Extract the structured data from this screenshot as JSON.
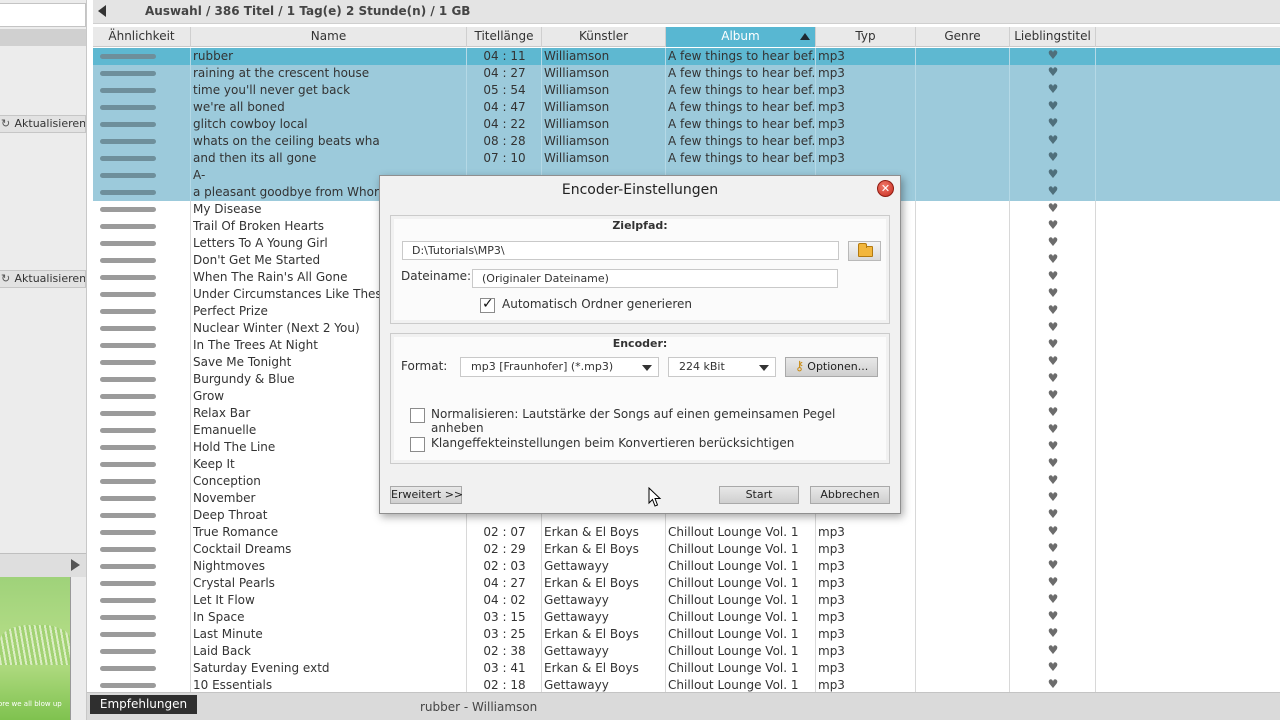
{
  "breadcrumb": "Auswahl  /  386 Titel  /  1 Tag(e) 2 Stunde(n)  /  1 GB",
  "sidebar": {
    "refresh_label": "Aktualisieren",
    "thumbnail_caption": "ore we all blow up"
  },
  "table": {
    "columns": [
      {
        "key": "sim",
        "label": "Ähnlichkeit"
      },
      {
        "key": "name",
        "label": "Name"
      },
      {
        "key": "len",
        "label": "Titellänge"
      },
      {
        "key": "artist",
        "label": "Künstler"
      },
      {
        "key": "album",
        "label": "Album",
        "sorted": "asc"
      },
      {
        "key": "type",
        "label": "Typ"
      },
      {
        "key": "genre",
        "label": "Genre"
      },
      {
        "key": "fav",
        "label": "Lieblingstitel"
      }
    ],
    "rows": [
      {
        "name": "rubber",
        "len": "04 : 11",
        "artist": "Williamson",
        "album": "A few things to hear bef...",
        "type": "mp3",
        "sel": true,
        "first": true
      },
      {
        "name": "raining at the crescent house",
        "len": "04 : 27",
        "artist": "Williamson",
        "album": "A few things to hear bef...",
        "type": "mp3",
        "sel": true
      },
      {
        "name": "time you'll never get back",
        "len": "05 : 54",
        "artist": "Williamson",
        "album": "A few things to hear bef...",
        "type": "mp3",
        "sel": true
      },
      {
        "name": "we're all boned",
        "len": "04 : 47",
        "artist": "Williamson",
        "album": "A few things to hear bef...",
        "type": "mp3",
        "sel": true
      },
      {
        "name": "glitch cowboy local",
        "len": "04 : 22",
        "artist": "Williamson",
        "album": "A few things to hear bef...",
        "type": "mp3",
        "sel": true
      },
      {
        "name": "whats on the ceiling beats wha",
        "len": "08 : 28",
        "artist": "Williamson",
        "album": "A few things to hear bef...",
        "type": "mp3",
        "sel": true
      },
      {
        "name": "and then its all gone",
        "len": "07 : 10",
        "artist": "Williamson",
        "album": "A few things to hear bef...",
        "type": "mp3",
        "sel": true
      },
      {
        "name": "A-",
        "len": "",
        "artist": "",
        "album": "",
        "type": "",
        "sel": true
      },
      {
        "name": "a pleasant goodbye from Whore",
        "len": "",
        "artist": "",
        "album": "",
        "type": "",
        "sel": true
      },
      {
        "name": "My Disease",
        "len": "",
        "artist": "",
        "album": "",
        "type": ""
      },
      {
        "name": "Trail Of Broken Hearts",
        "len": "",
        "artist": "",
        "album": "",
        "type": ""
      },
      {
        "name": "Letters To A Young Girl",
        "len": "",
        "artist": "",
        "album": "",
        "type": ""
      },
      {
        "name": "Don't Get Me Started",
        "len": "",
        "artist": "",
        "album": "",
        "type": ""
      },
      {
        "name": "When The Rain's All Gone",
        "len": "",
        "artist": "",
        "album": "",
        "type": ""
      },
      {
        "name": "Under Circumstances Like These",
        "len": "",
        "artist": "",
        "album": "",
        "type": ""
      },
      {
        "name": "Perfect Prize",
        "len": "",
        "artist": "",
        "album": "",
        "type": ""
      },
      {
        "name": "Nuclear Winter (Next 2 You)",
        "len": "",
        "artist": "",
        "album": "",
        "type": ""
      },
      {
        "name": "In The Trees At Night",
        "len": "",
        "artist": "",
        "album": "",
        "type": ""
      },
      {
        "name": "Save Me Tonight",
        "len": "",
        "artist": "",
        "album": "",
        "type": ""
      },
      {
        "name": "Burgundy & Blue",
        "len": "",
        "artist": "",
        "album": "",
        "type": ""
      },
      {
        "name": "Grow",
        "len": "",
        "artist": "",
        "album": "",
        "type": ""
      },
      {
        "name": "Relax Bar",
        "len": "",
        "artist": "",
        "album": "",
        "type": ""
      },
      {
        "name": "Emanuelle",
        "len": "",
        "artist": "",
        "album": "",
        "type": ""
      },
      {
        "name": "Hold The Line",
        "len": "",
        "artist": "",
        "album": "",
        "type": ""
      },
      {
        "name": "Keep It",
        "len": "",
        "artist": "",
        "album": "",
        "type": ""
      },
      {
        "name": "Conception",
        "len": "",
        "artist": "",
        "album": "",
        "type": ""
      },
      {
        "name": "November",
        "len": "",
        "artist": "",
        "album": "",
        "type": ""
      },
      {
        "name": "Deep Throat",
        "len": "",
        "artist": "",
        "album": "",
        "type": ""
      },
      {
        "name": "True Romance",
        "len": "02 : 07",
        "artist": "Erkan & El Boys",
        "album": "Chillout Lounge Vol. 1",
        "type": "mp3"
      },
      {
        "name": "Cocktail Dreams",
        "len": "02 : 29",
        "artist": "Erkan & El Boys",
        "album": "Chillout Lounge Vol. 1",
        "type": "mp3"
      },
      {
        "name": "Nightmoves",
        "len": "02 : 03",
        "artist": "Gettawayy",
        "album": "Chillout Lounge Vol. 1",
        "type": "mp3"
      },
      {
        "name": "Crystal Pearls",
        "len": "04 : 27",
        "artist": "Erkan & El Boys",
        "album": "Chillout Lounge Vol. 1",
        "type": "mp3"
      },
      {
        "name": "Let It Flow",
        "len": "04 : 02",
        "artist": "Gettawayy",
        "album": "Chillout Lounge Vol. 1",
        "type": "mp3"
      },
      {
        "name": "In Space",
        "len": "03 : 15",
        "artist": "Gettawayy",
        "album": "Chillout Lounge Vol. 1",
        "type": "mp3"
      },
      {
        "name": "Last Minute",
        "len": "03 : 25",
        "artist": "Erkan & El Boys",
        "album": "Chillout Lounge Vol. 1",
        "type": "mp3"
      },
      {
        "name": "Laid Back",
        "len": "02 : 38",
        "artist": "Gettawayy",
        "album": "Chillout Lounge Vol. 1",
        "type": "mp3"
      },
      {
        "name": "Saturday Evening extd",
        "len": "03 : 41",
        "artist": "Erkan & El Boys",
        "album": "Chillout Lounge Vol. 1",
        "type": "mp3"
      },
      {
        "name": "10 Essentials",
        "len": "02 : 18",
        "artist": "Gettawayy",
        "album": "Chillout Lounge Vol. 1",
        "type": "mp3"
      }
    ]
  },
  "statusbar": {
    "recommendations_label": "Empfehlungen",
    "now_playing": "rubber - Williamson"
  },
  "dialog": {
    "title": "Encoder-Einstellungen",
    "target_group_title": "Zielpfad:",
    "target_path": "D:\\Tutorials\\MP3\\",
    "filename_label": "Dateiname:",
    "filename_value": "(Originaler Dateiname)",
    "auto_folder_label": "Automatisch Ordner generieren",
    "auto_folder_checked": true,
    "encoder_group_title": "Encoder:",
    "format_label": "Format:",
    "format_value": "mp3 [Fraunhofer] (*.mp3)",
    "bitrate_value": "224 kBit",
    "options_label": "Optionen...",
    "normalize_label": "Normalisieren: Lautstärke der Songs auf einen gemeinsamen Pegel anheben",
    "normalize_checked": false,
    "effects_label": "Klangeffekteinstellungen beim Konvertieren berücksichtigen",
    "effects_checked": false,
    "advanced_label": "Erweitert >>",
    "start_label": "Start",
    "cancel_label": "Abbrechen"
  },
  "icons": {
    "back": "back-arrow-icon",
    "refresh": "refresh-icon",
    "close": "close-icon",
    "folder": "folder-icon",
    "key": "key-icon",
    "heart": "heart-icon",
    "play": "play-icon"
  },
  "colors": {
    "selected_row": "#9ccadb",
    "focused_row": "#5eb8d1",
    "sorted_header": "#58b7d2",
    "close_button": "#d43a2c"
  }
}
